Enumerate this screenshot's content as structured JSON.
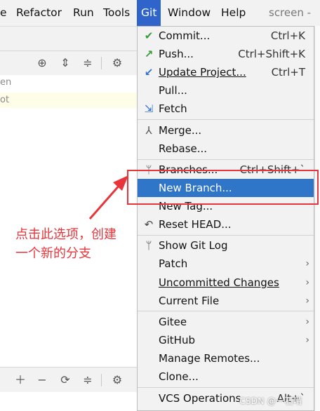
{
  "menubar": {
    "items": [
      "e",
      "Refactor",
      "Run",
      "Tools",
      "Git",
      "Window",
      "Help"
    ],
    "title": "screen - p"
  },
  "left_panel": {
    "fragment_1": "en",
    "fragment_2": "ot"
  },
  "git_menu": {
    "items": [
      {
        "label": "Commit...",
        "shortcut": "Ctrl+K",
        "icon": "check-icon"
      },
      {
        "label": "Push...",
        "shortcut": "Ctrl+Shift+K",
        "icon": "push-arrow-icon"
      },
      {
        "label": "Update Project...",
        "shortcut": "Ctrl+T",
        "icon": "update-arrow-icon"
      },
      {
        "label": "Pull...",
        "shortcut": "",
        "icon": ""
      },
      {
        "label": "Fetch",
        "shortcut": "",
        "icon": "fetch-icon"
      },
      {
        "label": "Merge...",
        "shortcut": "",
        "icon": "merge-icon"
      },
      {
        "label": "Rebase...",
        "shortcut": "",
        "icon": ""
      },
      {
        "label": "Branches...",
        "shortcut": "Ctrl+Shift+`",
        "icon": "branch-icon"
      },
      {
        "label": "New Branch...",
        "shortcut": "",
        "icon": ""
      },
      {
        "label": "New Tag...",
        "shortcut": "",
        "icon": ""
      },
      {
        "label": "Reset HEAD...",
        "shortcut": "",
        "icon": "reset-icon"
      },
      {
        "label": "Show Git Log",
        "shortcut": "",
        "icon": "git-log-icon"
      },
      {
        "label": "Patch",
        "shortcut": "",
        "icon": ""
      },
      {
        "label": "Uncommitted Changes",
        "shortcut": "",
        "icon": ""
      },
      {
        "label": "Current File",
        "shortcut": "",
        "icon": ""
      },
      {
        "label": "Gitee",
        "shortcut": "",
        "icon": ""
      },
      {
        "label": "GitHub",
        "shortcut": "",
        "icon": ""
      },
      {
        "label": "Manage Remotes...",
        "shortcut": "",
        "icon": ""
      },
      {
        "label": "Clone...",
        "shortcut": "",
        "icon": ""
      },
      {
        "label": "VCS Operations",
        "shortcut": "Alt+`",
        "icon": ""
      }
    ]
  },
  "annotation": {
    "line1": "点击此选项，创建",
    "line2": "一个新的分支"
  },
  "watermark": "CSDN @一石啃",
  "colors": {
    "menu_highlight": "#2f76c9",
    "annotation_red": "#e8353b"
  }
}
